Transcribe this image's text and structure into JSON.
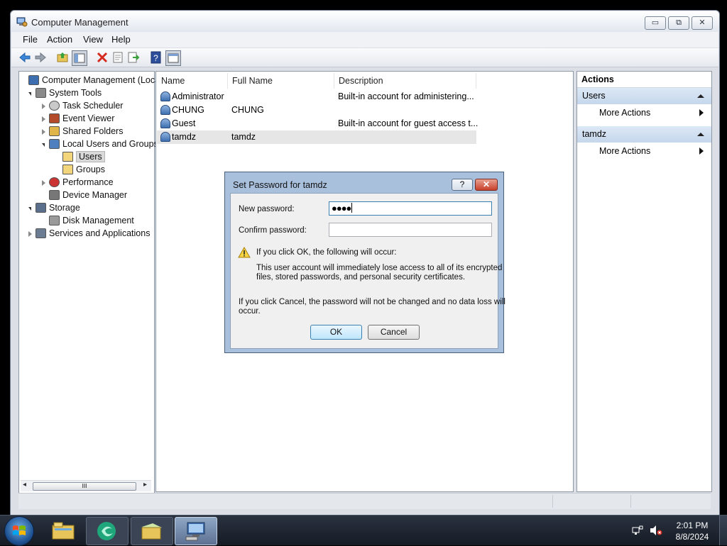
{
  "window": {
    "title": "Computer Management",
    "minimize_glyph": "▭",
    "maximize_glyph": "⧉",
    "close_glyph": "✕"
  },
  "menu": [
    "File",
    "Action",
    "View",
    "Help"
  ],
  "toolbar_icons": [
    "back-icon",
    "forward-icon",
    "up-folder-icon",
    "show-hide-tree-icon",
    "delete-icon",
    "properties-icon",
    "export-list-icon",
    "help-icon",
    "console-tree-icon"
  ],
  "tree": [
    {
      "label": "Computer Management (Local",
      "level": 0,
      "expander": "none",
      "icon": "computer-management-icon"
    },
    {
      "label": "System Tools",
      "level": 1,
      "expander": "open",
      "icon": "tools-icon"
    },
    {
      "label": "Task Scheduler",
      "level": 2,
      "expander": "closed",
      "icon": "clock-icon"
    },
    {
      "label": "Event Viewer",
      "level": 2,
      "expander": "closed",
      "icon": "event-viewer-icon"
    },
    {
      "label": "Shared Folders",
      "level": 2,
      "expander": "closed",
      "icon": "shared-folders-icon"
    },
    {
      "label": "Local Users and Groups",
      "level": 2,
      "expander": "open",
      "icon": "users-groups-icon"
    },
    {
      "label": "Users",
      "level": 3,
      "expander": "none",
      "icon": "folder-icon",
      "selected": true
    },
    {
      "label": "Groups",
      "level": 3,
      "expander": "none",
      "icon": "folder-icon"
    },
    {
      "label": "Performance",
      "level": 2,
      "expander": "closed",
      "icon": "performance-icon"
    },
    {
      "label": "Device Manager",
      "level": 2,
      "expander": "none",
      "icon": "device-manager-icon"
    },
    {
      "label": "Storage",
      "level": 1,
      "expander": "open",
      "icon": "storage-icon"
    },
    {
      "label": "Disk Management",
      "level": 2,
      "expander": "none",
      "icon": "disk-icon"
    },
    {
      "label": "Services and Applications",
      "level": 1,
      "expander": "closed",
      "icon": "services-icon"
    }
  ],
  "tree_scrollbar": {
    "grip": "III",
    "left_arrow": "◂",
    "right_arrow": "▸"
  },
  "list": {
    "columns": [
      "Name",
      "Full Name",
      "Description"
    ],
    "rows": [
      {
        "name": "Administrator",
        "full_name": "",
        "description": "Built-in account for administering..."
      },
      {
        "name": "CHUNG",
        "full_name": "CHUNG",
        "description": ""
      },
      {
        "name": "Guest",
        "full_name": "",
        "description": "Built-in account for guest access t..."
      },
      {
        "name": "tamdz",
        "full_name": "tamdz",
        "description": "",
        "selected": true
      }
    ]
  },
  "actions": {
    "header": "Actions",
    "groups": [
      {
        "title": "Users",
        "item": "More Actions"
      },
      {
        "title": "tamdz",
        "item": "More Actions"
      }
    ]
  },
  "dialog": {
    "title": "Set Password for tamdz",
    "help_glyph": "?",
    "close_glyph": "✕",
    "new_password_label": "New password:",
    "new_password_value": "●●●●",
    "confirm_password_label": "Confirm password:",
    "confirm_password_value": "",
    "warning_heading": "If you click OK, the following will occur:",
    "warning_line1": "This user account will immediately lose access to all of its encrypted",
    "warning_line2": "files, stored passwords, and personal security certificates.",
    "cancel_note_line1": "If you click Cancel, the password will not be changed and no data loss will",
    "cancel_note_line2": "occur.",
    "ok_label": "OK",
    "cancel_label": "Cancel"
  },
  "taskbar": {
    "time": "2:01 PM",
    "date": "8/8/2024",
    "buttons": [
      "explorer-icon",
      "browser-icon",
      "windows-explorer-icon",
      "computer-management-icon"
    ]
  },
  "colors": {
    "selection": "#cce8ff",
    "actions_group": "#c6d7ec",
    "dialog_frame": "#a9c0dc"
  }
}
